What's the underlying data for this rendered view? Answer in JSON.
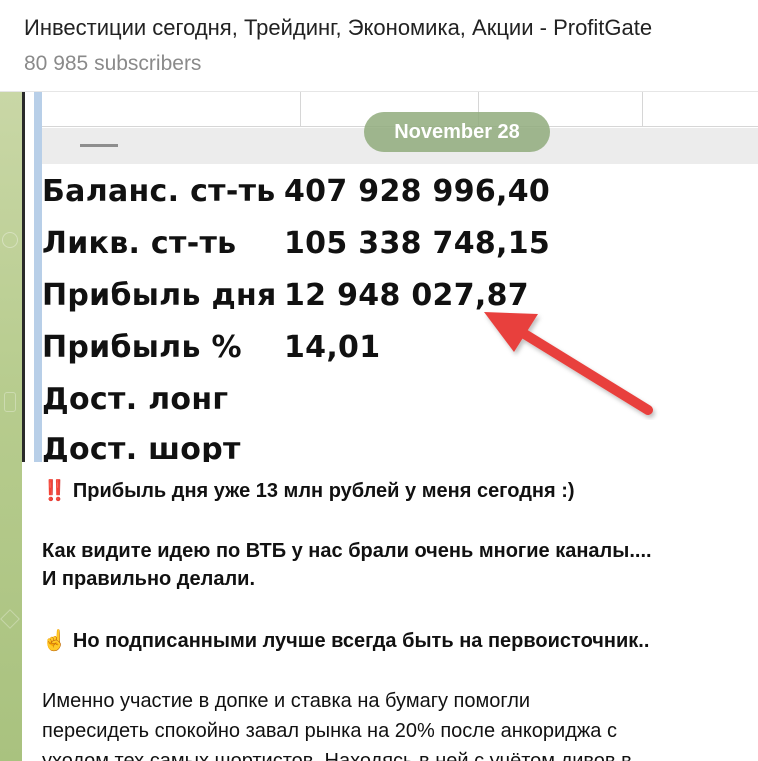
{
  "header": {
    "title": "Инвестиции сегодня, Трейдинг, Экономика, Акции - ProfitGate",
    "subscribers": "80 985 subscribers"
  },
  "date_pill": "November 28",
  "table": {
    "rows": [
      {
        "label": "Баланс. ст-ть",
        "value": "407 928 996,40"
      },
      {
        "label": "Ликв. ст-ть",
        "value": "105 338 748,15"
      },
      {
        "label": "Прибыль дня",
        "value": "12 948 027,87"
      },
      {
        "label": "Прибыль %",
        "value": "14,01"
      },
      {
        "label": "Дост. лонг",
        "value": ""
      },
      {
        "label": "Дост. шорт",
        "value": ""
      }
    ]
  },
  "message": {
    "emoji1": "‼️",
    "line1": "Прибыль дня уже 13 млн рублей у меня сегодня :)",
    "line2": "Как видите идею по ВТБ у нас брали очень многие каналы....",
    "line3": "И правильно делали.",
    "emoji2": "☝️",
    "line4": "Но подписанными лучше всегда быть на первоисточник..",
    "line5": "Именно участие в допке и ставка на бумагу помогли",
    "line6": "пересидеть спокойно завал рынка на 20% после анкориджа с",
    "line7": "уходом тех самых шортистов. Находясь в ней с учётом дивов в"
  },
  "colors": {
    "arrow": "#e8403c",
    "date_pill": "#91ac7d",
    "blue_strip": "#b8cfe8"
  }
}
